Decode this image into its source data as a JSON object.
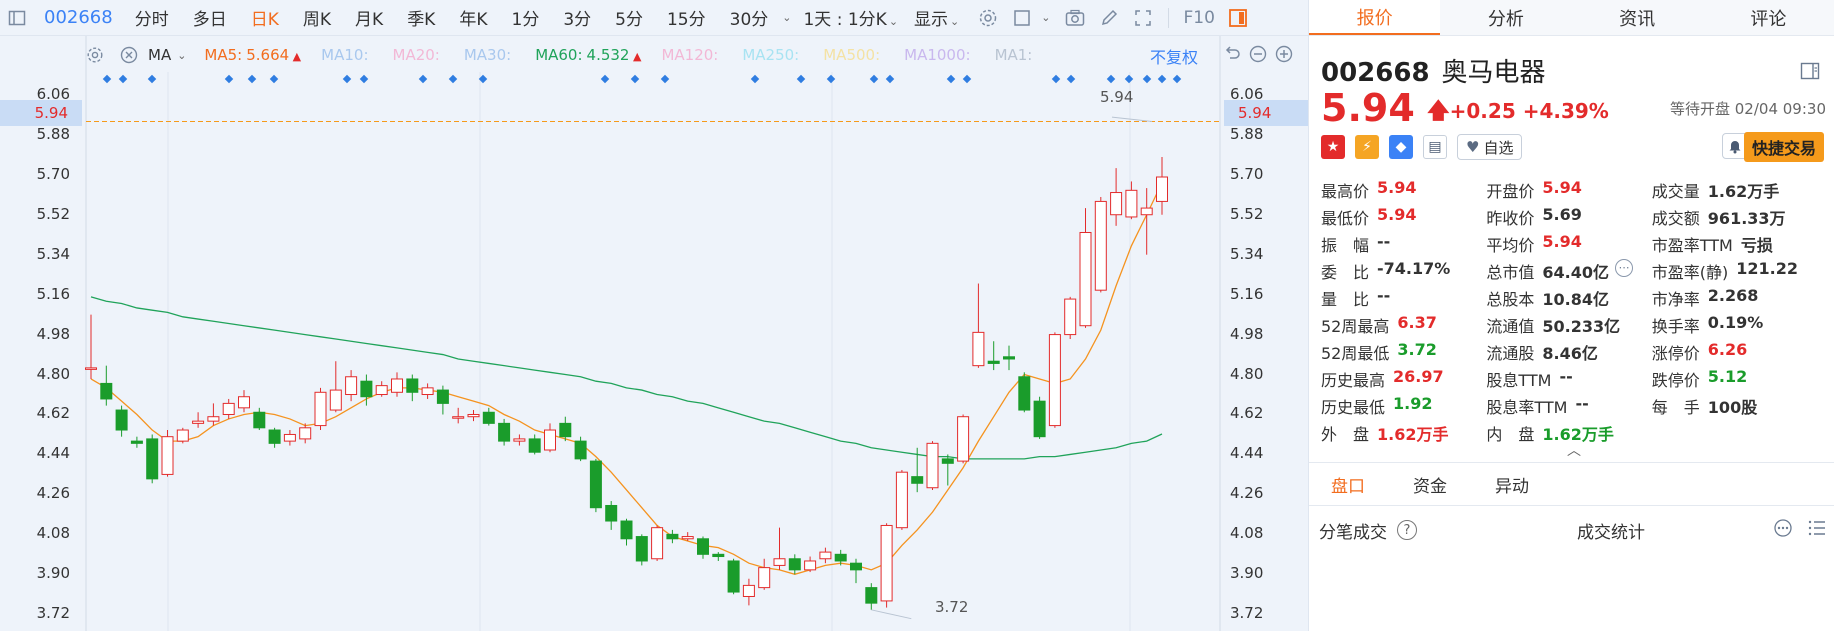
{
  "toolbar": {
    "code": "002668",
    "periods": [
      {
        "label": "分时",
        "active": false
      },
      {
        "label": "多日",
        "active": false
      },
      {
        "label": "日K",
        "active": true
      },
      {
        "label": "周K",
        "active": false
      },
      {
        "label": "月K",
        "active": false
      },
      {
        "label": "季K",
        "active": false
      },
      {
        "label": "年K",
        "active": false
      },
      {
        "label": "1分",
        "active": false
      },
      {
        "label": "3分",
        "active": false
      },
      {
        "label": "5分",
        "active": false
      },
      {
        "label": "15分",
        "active": false
      },
      {
        "label": "30分",
        "active": false
      }
    ],
    "range_label": "1天 : 1分K",
    "display_label": "显示",
    "f10_label": "F10"
  },
  "ma_legend": {
    "indicator": "MA",
    "items": [
      {
        "label": "MA5:",
        "value": "5.664",
        "color": "#f26d1f",
        "dim": false,
        "arrow": true
      },
      {
        "label": "MA10:",
        "value": "",
        "color": "#a9c8ee",
        "dim": true,
        "arrow": false
      },
      {
        "label": "MA20:",
        "value": "",
        "color": "#f2b8d6",
        "dim": true,
        "arrow": false
      },
      {
        "label": "MA30:",
        "value": "",
        "color": "#a9c8ee",
        "dim": true,
        "arrow": false
      },
      {
        "label": "MA60:",
        "value": "4.532",
        "color": "#20a35a",
        "dim": false,
        "arrow": true
      },
      {
        "label": "MA120:",
        "value": "",
        "color": "#f2b8d6",
        "dim": true,
        "arrow": false
      },
      {
        "label": "MA250:",
        "value": "",
        "color": "#a8e3f2",
        "dim": true,
        "arrow": false
      },
      {
        "label": "MA500:",
        "value": "",
        "color": "#f4e2a4",
        "dim": true,
        "arrow": false
      },
      {
        "label": "MA1000:",
        "value": "",
        "color": "#c9b8ee",
        "dim": true,
        "arrow": false
      },
      {
        "label": "MA1:",
        "value": "",
        "color": "#b9c4d2",
        "dim": true,
        "arrow": false
      }
    ],
    "adjust_label": "不复权"
  },
  "axis": {
    "ticks": [
      "6.06",
      "5.88",
      "5.70",
      "5.52",
      "5.34",
      "5.16",
      "4.98",
      "4.80",
      "4.62",
      "4.44",
      "4.26",
      "4.08",
      "3.90",
      "3.72"
    ],
    "current": "5.94"
  },
  "annotations": {
    "high": "5.94",
    "low": "3.72"
  },
  "chart_data": {
    "type": "candlestick",
    "ylim": [
      3.64,
      6.1
    ],
    "high_label": "5.94",
    "low_label": "3.72",
    "current_price": 5.94,
    "up_color": "#e32b2b",
    "down_color": "#1a9c2b",
    "candles": [
      {
        "o": 4.83,
        "c": 4.83,
        "h": 5.07,
        "l": 4.78
      },
      {
        "o": 4.76,
        "c": 4.69,
        "h": 4.84,
        "l": 4.66
      },
      {
        "o": 4.64,
        "c": 4.55,
        "h": 4.66,
        "l": 4.52
      },
      {
        "o": 4.5,
        "c": 4.49,
        "h": 4.52,
        "l": 4.47
      },
      {
        "o": 4.51,
        "c": 4.33,
        "h": 4.53,
        "l": 4.31
      },
      {
        "o": 4.35,
        "c": 4.52,
        "h": 4.55,
        "l": 4.34
      },
      {
        "o": 4.5,
        "c": 4.55,
        "h": 4.56,
        "l": 4.49
      },
      {
        "o": 4.58,
        "c": 4.59,
        "h": 4.63,
        "l": 4.56
      },
      {
        "o": 4.59,
        "c": 4.61,
        "h": 4.67,
        "l": 4.57
      },
      {
        "o": 4.62,
        "c": 4.67,
        "h": 4.69,
        "l": 4.6
      },
      {
        "o": 4.65,
        "c": 4.7,
        "h": 4.73,
        "l": 4.63
      },
      {
        "o": 4.63,
        "c": 4.56,
        "h": 4.65,
        "l": 4.55
      },
      {
        "o": 4.55,
        "c": 4.49,
        "h": 4.56,
        "l": 4.47
      },
      {
        "o": 4.5,
        "c": 4.53,
        "h": 4.55,
        "l": 4.48
      },
      {
        "o": 4.51,
        "c": 4.56,
        "h": 4.58,
        "l": 4.49
      },
      {
        "o": 4.57,
        "c": 4.72,
        "h": 4.74,
        "l": 4.55
      },
      {
        "o": 4.64,
        "c": 4.73,
        "h": 4.86,
        "l": 4.63
      },
      {
        "o": 4.71,
        "c": 4.79,
        "h": 4.82,
        "l": 4.68
      },
      {
        "o": 4.77,
        "c": 4.7,
        "h": 4.8,
        "l": 4.66
      },
      {
        "o": 4.71,
        "c": 4.75,
        "h": 4.77,
        "l": 4.7
      },
      {
        "o": 4.72,
        "c": 4.78,
        "h": 4.81,
        "l": 4.7
      },
      {
        "o": 4.78,
        "c": 4.72,
        "h": 4.8,
        "l": 4.68
      },
      {
        "o": 4.71,
        "c": 4.74,
        "h": 4.76,
        "l": 4.69
      },
      {
        "o": 4.73,
        "c": 4.67,
        "h": 4.75,
        "l": 4.62
      },
      {
        "o": 4.61,
        "c": 4.61,
        "h": 4.65,
        "l": 4.58
      },
      {
        "o": 4.61,
        "c": 4.62,
        "h": 4.64,
        "l": 4.59
      },
      {
        "o": 4.63,
        "c": 4.58,
        "h": 4.65,
        "l": 4.57
      },
      {
        "o": 4.58,
        "c": 4.5,
        "h": 4.6,
        "l": 4.48
      },
      {
        "o": 4.5,
        "c": 4.51,
        "h": 4.53,
        "l": 4.48
      },
      {
        "o": 4.51,
        "c": 4.45,
        "h": 4.53,
        "l": 4.44
      },
      {
        "o": 4.46,
        "c": 4.55,
        "h": 4.58,
        "l": 4.45
      },
      {
        "o": 4.58,
        "c": 4.52,
        "h": 4.61,
        "l": 4.5
      },
      {
        "o": 4.5,
        "c": 4.42,
        "h": 4.52,
        "l": 4.41
      },
      {
        "o": 4.41,
        "c": 4.2,
        "h": 4.42,
        "l": 4.18
      },
      {
        "o": 4.21,
        "c": 4.14,
        "h": 4.23,
        "l": 4.1
      },
      {
        "o": 4.14,
        "c": 4.06,
        "h": 4.15,
        "l": 4.03
      },
      {
        "o": 4.07,
        "c": 3.96,
        "h": 4.08,
        "l": 3.94
      },
      {
        "o": 3.97,
        "c": 4.11,
        "h": 4.12,
        "l": 3.96
      },
      {
        "o": 4.08,
        "c": 4.06,
        "h": 4.1,
        "l": 4.04
      },
      {
        "o": 4.06,
        "c": 4.07,
        "h": 4.09,
        "l": 4.05
      },
      {
        "o": 4.06,
        "c": 3.99,
        "h": 4.07,
        "l": 3.97
      },
      {
        "o": 3.99,
        "c": 3.98,
        "h": 4.0,
        "l": 3.96
      },
      {
        "o": 3.96,
        "c": 3.82,
        "h": 3.97,
        "l": 3.81
      },
      {
        "o": 3.8,
        "c": 3.85,
        "h": 3.88,
        "l": 3.76
      },
      {
        "o": 3.84,
        "c": 3.93,
        "h": 3.97,
        "l": 3.83
      },
      {
        "o": 3.94,
        "c": 3.97,
        "h": 4.11,
        "l": 3.92
      },
      {
        "o": 3.97,
        "c": 3.92,
        "h": 3.99,
        "l": 3.9
      },
      {
        "o": 3.92,
        "c": 3.96,
        "h": 3.98,
        "l": 3.91
      },
      {
        "o": 3.97,
        "c": 4.0,
        "h": 4.02,
        "l": 3.95
      },
      {
        "o": 3.99,
        "c": 3.96,
        "h": 4.01,
        "l": 3.94
      },
      {
        "o": 3.95,
        "c": 3.92,
        "h": 3.97,
        "l": 3.86
      },
      {
        "o": 3.84,
        "c": 3.77,
        "h": 3.86,
        "l": 3.74
      },
      {
        "o": 3.78,
        "c": 4.12,
        "h": 4.13,
        "l": 3.75
      },
      {
        "o": 4.11,
        "c": 4.36,
        "h": 4.37,
        "l": 4.1
      },
      {
        "o": 4.34,
        "c": 4.31,
        "h": 4.47,
        "l": 4.27
      },
      {
        "o": 4.29,
        "c": 4.49,
        "h": 4.5,
        "l": 4.28
      },
      {
        "o": 4.42,
        "c": 4.4,
        "h": 4.44,
        "l": 4.3
      },
      {
        "o": 4.41,
        "c": 4.61,
        "h": 4.62,
        "l": 4.4
      },
      {
        "o": 4.84,
        "c": 4.99,
        "h": 5.21,
        "l": 4.83
      },
      {
        "o": 4.86,
        "c": 4.85,
        "h": 4.95,
        "l": 4.82
      },
      {
        "o": 4.88,
        "c": 4.87,
        "h": 4.93,
        "l": 4.82
      },
      {
        "o": 4.79,
        "c": 4.64,
        "h": 4.81,
        "l": 4.63
      },
      {
        "o": 4.68,
        "c": 4.52,
        "h": 4.7,
        "l": 4.51
      },
      {
        "o": 4.57,
        "c": 4.98,
        "h": 4.99,
        "l": 4.56
      },
      {
        "o": 4.98,
        "c": 5.14,
        "h": 5.15,
        "l": 4.96
      },
      {
        "o": 5.02,
        "c": 5.44,
        "h": 5.55,
        "l": 5.01
      },
      {
        "o": 5.18,
        "c": 5.58,
        "h": 5.6,
        "l": 5.17
      },
      {
        "o": 5.52,
        "c": 5.62,
        "h": 5.73,
        "l": 5.47
      },
      {
        "o": 5.51,
        "c": 5.63,
        "h": 5.67,
        "l": 5.5
      },
      {
        "o": 5.52,
        "c": 5.55,
        "h": 5.64,
        "l": 5.34
      },
      {
        "o": 5.58,
        "c": 5.69,
        "h": 5.78,
        "l": 5.52
      }
    ],
    "ma5": [
      4.78,
      4.74,
      4.68,
      4.62,
      4.55,
      4.5,
      4.5,
      4.52,
      4.57,
      4.6,
      4.62,
      4.63,
      4.62,
      4.6,
      4.57,
      4.58,
      4.61,
      4.65,
      4.69,
      4.72,
      4.74,
      4.74,
      4.73,
      4.72,
      4.7,
      4.68,
      4.66,
      4.62,
      4.59,
      4.55,
      4.53,
      4.51,
      4.49,
      4.43,
      4.36,
      4.28,
      4.2,
      4.12,
      4.07,
      4.05,
      4.03,
      4.02,
      3.99,
      3.95,
      3.93,
      3.92,
      3.9,
      3.92,
      3.94,
      3.95,
      3.94,
      3.92,
      3.95,
      4.03,
      4.1,
      4.18,
      4.28,
      4.38,
      4.5,
      4.61,
      4.72,
      4.8,
      4.78,
      4.76,
      4.78,
      4.87,
      5.0,
      5.2,
      5.38,
      5.52,
      5.664
    ],
    "ma60": [
      5.15,
      5.13,
      5.12,
      5.1,
      5.09,
      5.08,
      5.06,
      5.05,
      5.04,
      5.03,
      5.02,
      5.01,
      5.0,
      4.99,
      4.98,
      4.97,
      4.96,
      4.95,
      4.94,
      4.93,
      4.92,
      4.91,
      4.9,
      4.89,
      4.87,
      4.86,
      4.85,
      4.84,
      4.83,
      4.82,
      4.81,
      4.8,
      4.79,
      4.77,
      4.76,
      4.74,
      4.73,
      4.71,
      4.7,
      4.68,
      4.67,
      4.65,
      4.63,
      4.61,
      4.59,
      4.58,
      4.56,
      4.54,
      4.52,
      4.5,
      4.49,
      4.47,
      4.46,
      4.45,
      4.44,
      4.43,
      4.43,
      4.42,
      4.42,
      4.42,
      4.42,
      4.42,
      4.43,
      4.43,
      4.44,
      4.45,
      4.46,
      4.47,
      4.49,
      4.5,
      4.532
    ]
  },
  "panel": {
    "tabs": [
      {
        "label": "报价",
        "active": true
      },
      {
        "label": "分析",
        "active": false
      },
      {
        "label": "资讯",
        "active": false
      },
      {
        "label": "评论",
        "active": false
      }
    ],
    "code": "002668",
    "name": "奥马电器",
    "price": "5.94",
    "change": "+0.25",
    "change_pct": "+4.39%",
    "status": "等待开盘 02/04 09:30",
    "watch_label": "自选",
    "quick_trade_label": "快捷交易",
    "stats": [
      [
        {
          "k": "最高价",
          "v": "5.94",
          "c": "red"
        },
        {
          "k": "开盘价",
          "v": "5.94",
          "c": "red"
        },
        {
          "k": "成交量",
          "v": "1.62万手",
          "c": "dark"
        }
      ],
      [
        {
          "k": "最低价",
          "v": "5.94",
          "c": "red"
        },
        {
          "k": "昨收价",
          "v": "5.69",
          "c": "dark"
        },
        {
          "k": "成交额",
          "v": "961.33万",
          "c": "dark"
        }
      ],
      [
        {
          "k": "振　幅",
          "v": "--",
          "c": "dark"
        },
        {
          "k": "平均价",
          "v": "5.94",
          "c": "red"
        },
        {
          "k": "市盈率TTM",
          "v": "亏损",
          "c": "dark"
        }
      ],
      [
        {
          "k": "委　比",
          "v": "-74.17%",
          "c": "dark"
        },
        {
          "k": "总市值",
          "v": "64.40亿",
          "c": "dark"
        },
        {
          "k": "市盈率(静)",
          "v": "121.22",
          "c": "dark"
        }
      ],
      [
        {
          "k": "量　比",
          "v": "--",
          "c": "dark"
        },
        {
          "k": "总股本",
          "v": "10.84亿",
          "c": "dark"
        },
        {
          "k": "市净率",
          "v": "2.268",
          "c": "dark"
        }
      ],
      [
        {
          "k": "52周最高",
          "v": "6.37",
          "c": "red"
        },
        {
          "k": "流通值",
          "v": "50.233亿",
          "c": "dark"
        },
        {
          "k": "换手率",
          "v": "0.19%",
          "c": "dark"
        }
      ],
      [
        {
          "k": "52周最低",
          "v": "3.72",
          "c": "green"
        },
        {
          "k": "流通股",
          "v": "8.46亿",
          "c": "dark"
        },
        {
          "k": "涨停价",
          "v": "6.26",
          "c": "red"
        }
      ],
      [
        {
          "k": "历史最高",
          "v": "26.97",
          "c": "red"
        },
        {
          "k": "股息TTM",
          "v": "--",
          "c": "dark"
        },
        {
          "k": "跌停价",
          "v": "5.12",
          "c": "green"
        }
      ],
      [
        {
          "k": "历史最低",
          "v": "1.92",
          "c": "green"
        },
        {
          "k": "股息率TTM",
          "v": "--",
          "c": "dark"
        },
        {
          "k": "每　手",
          "v": "100股",
          "c": "dark"
        }
      ],
      [
        {
          "k": "外　盘",
          "v": "1.62万手",
          "c": "red"
        },
        {
          "k": "内　盘",
          "v": "1.62万手",
          "c": "green"
        },
        {
          "k": "",
          "v": "",
          "c": "dark"
        }
      ]
    ],
    "subtabs": [
      {
        "label": "盘口",
        "active": true
      },
      {
        "label": "资金",
        "active": false
      },
      {
        "label": "异动",
        "active": false
      }
    ],
    "bottom_left": "分笔成交",
    "bottom_mid": "成交统计"
  }
}
